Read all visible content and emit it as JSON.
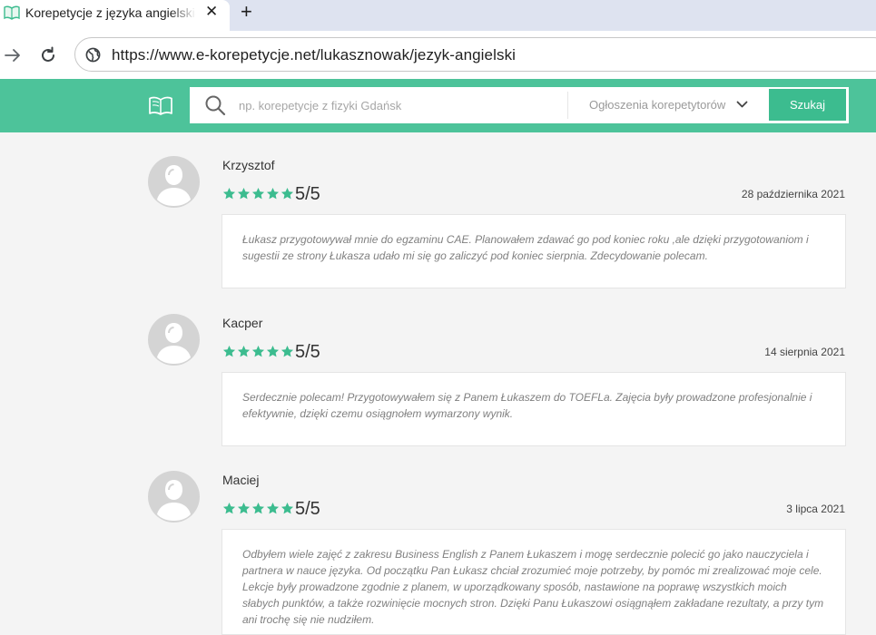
{
  "browser": {
    "tab_title": "Korepetycje z języka angielskiego",
    "tab_close": "✕",
    "new_tab": "+",
    "url": "https://www.e-korepetycje.net/lukasznowak/jezyk-angielski"
  },
  "header": {
    "search_placeholder": "np. korepetycje z fizyki Gdańsk",
    "category": "Ogłoszenia korepetytorów",
    "search_button": "Szukaj",
    "accent_color": "#4dc39a"
  },
  "reviews": [
    {
      "name": "Krzysztof",
      "rating": 5,
      "rating_text": "5/5",
      "date": "28 października 2021",
      "text": "Łukasz przygotowywał mnie do egzaminu CAE. Planowałem zdawać go pod koniec roku ,ale dzięki przygotowaniom i sugestii ze strony Łukasza udało mi się go zaliczyć pod koniec sierpnia. Zdecydowanie polecam."
    },
    {
      "name": "Kacper",
      "rating": 5,
      "rating_text": "5/5",
      "date": "14 sierpnia 2021",
      "text": "Serdecznie polecam! Przygotowywałem się z Panem Łukaszem do TOEFLa. Zajęcia były prowadzone profesjonalnie i efektywnie, dzięki czemu osiągnołem wymarzony wynik."
    },
    {
      "name": "Maciej",
      "rating": 5,
      "rating_text": "5/5",
      "date": "3 lipca 2021",
      "text": "Odbyłem wiele zajęć z zakresu Business English z Panem Łukaszem i mogę serdecznie polecić go jako nauczyciela i partnera w nauce języka. Od początku Pan Łukasz chciał zrozumieć moje potrzeby, by pomóc mi zrealizować moje cele. Lekcje były prowadzone zgodnie z planem, w uporządkowany sposób, nastawione na poprawę wszystkich moich słabych punktów, a także rozwinięcie mocnych stron. Dzięki Panu Łukaszowi osiągnąłem zakładane rezultaty, a przy tym ani trochę się nie nudziłem."
    }
  ],
  "icons": {
    "star_color": "#3cbc8f",
    "avatar_color": "#d4d4d4"
  }
}
